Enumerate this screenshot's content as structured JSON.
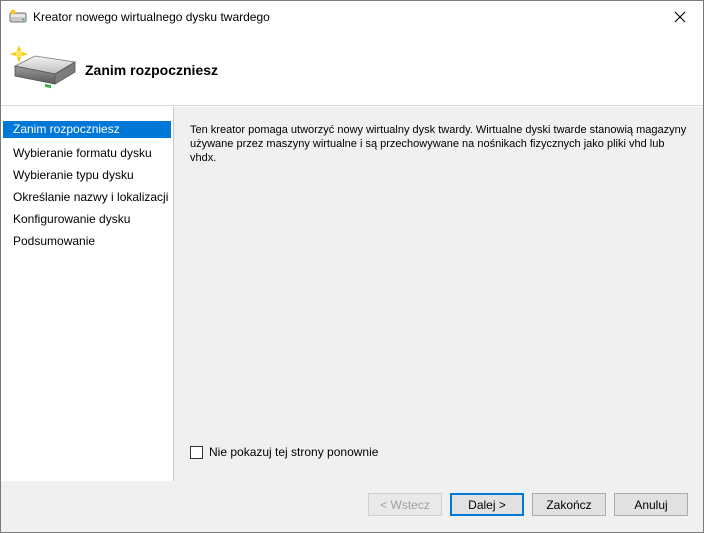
{
  "window": {
    "title": "Kreator nowego wirtualnego dysku twardego"
  },
  "header": {
    "title": "Zanim rozpoczniesz"
  },
  "nav": {
    "items": [
      {
        "label": "Zanim rozpoczniesz",
        "active": true
      },
      {
        "label": "Wybieranie formatu dysku",
        "active": false
      },
      {
        "label": "Wybieranie typu dysku",
        "active": false
      },
      {
        "label": "Określanie nazwy i lokalizacji",
        "active": false
      },
      {
        "label": "Konfigurowanie dysku",
        "active": false
      },
      {
        "label": "Podsumowanie",
        "active": false
      }
    ]
  },
  "content": {
    "description": "Ten kreator pomaga utworzyć nowy wirtualny dysk twardy. Wirtualne dyski twarde stanowią magazyny używane przez maszyny wirtualne i są przechowywane na nośnikach fizycznych jako pliki vhd lub vhdx.",
    "checkbox_label": "Nie pokazuj tej strony ponownie",
    "checkbox_checked": false
  },
  "footer": {
    "back_label": "< Wstecz",
    "next_label": "Dalej >",
    "finish_label": "Zakończ",
    "cancel_label": "Anuluj"
  },
  "colors": {
    "accent": "#0078d7",
    "panel": "#f0f0f0"
  }
}
